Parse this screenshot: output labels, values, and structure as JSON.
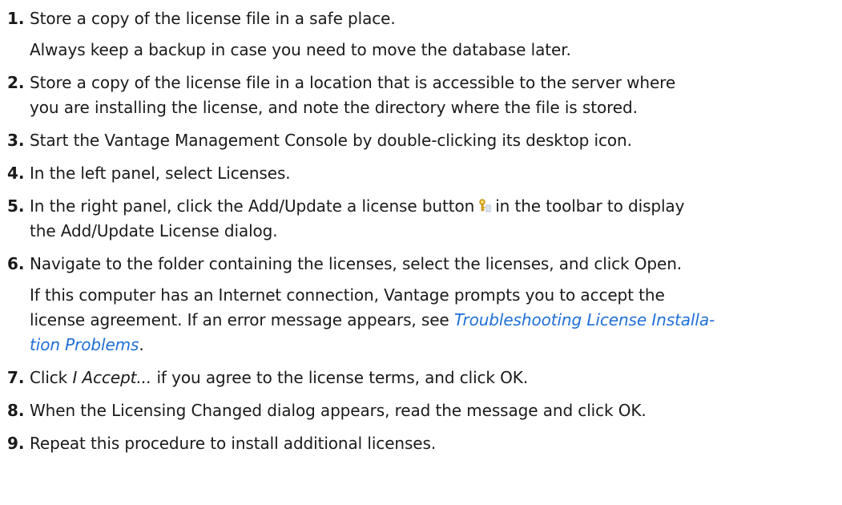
{
  "steps": [
    {
      "num": "1.",
      "text": "Store a copy of the license file in a safe place.",
      "note": "Always keep a backup in case you need to move the database later."
    },
    {
      "num": "2.",
      "line1": "Store a copy of the license file in a location that is accessible to the server where",
      "line2": "you are installing the license, and note the directory where the file is stored."
    },
    {
      "num": "3.",
      "text": "Start the Vantage Management Console by double-clicking its desktop icon."
    },
    {
      "num": "4.",
      "text": "In the left panel, select Licenses."
    },
    {
      "num": "5.",
      "before_icon": "In the right panel, click the Add/Update a license button",
      "after_icon": "in the toolbar to display",
      "line2": "the Add/Update License dialog.",
      "icon": "license-key-icon"
    },
    {
      "num": "6.",
      "text": "Navigate to the folder containing the licenses, select the licenses, and click Open.",
      "note_line1": "If this computer has an Internet connection, Vantage prompts you to accept the",
      "note_line2_before": "license agreement. If an error message appears, see",
      "link_part1": "Troubleshooting License Installa-",
      "link_part2": "tion Problems",
      "note_end": "."
    },
    {
      "num": "7.",
      "before": "Click",
      "italic": "I Accept...",
      "after": "if you agree to the license terms, and click OK."
    },
    {
      "num": "8.",
      "text": "When the Licensing Changed dialog appears, read the message and click OK."
    },
    {
      "num": "9.",
      "text": "Repeat this procedure to install additional licenses."
    }
  ],
  "colors": {
    "text": "#1a1a1a",
    "link": "#1f6fd6"
  }
}
